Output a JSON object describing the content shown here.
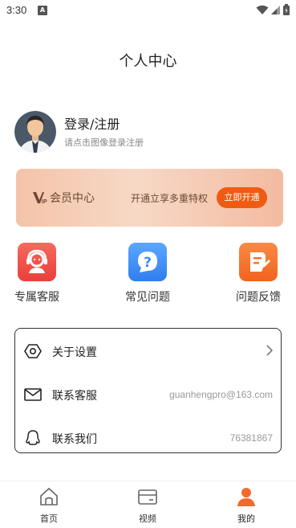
{
  "status_bar": {
    "time": "3:30",
    "notification_letter": "A"
  },
  "header": {
    "title": "个人中心"
  },
  "profile": {
    "name": "登录/注册",
    "subtitle": "请点击图像登录注册"
  },
  "vip": {
    "title": "会员中心",
    "promo": "开通立享多重特权",
    "button": "立即开通",
    "accent": "#ef5b12"
  },
  "quick_actions": [
    {
      "label": "专属客服",
      "icon": "headset-agent-icon",
      "color": "#f0514a"
    },
    {
      "label": "常见问题",
      "icon": "question-bubble-icon",
      "color": "#3d8cf5"
    },
    {
      "label": "问题反馈",
      "icon": "feedback-edit-icon",
      "color": "#f4742c"
    }
  ],
  "menu": [
    {
      "label": "关于设置",
      "value": "",
      "icon": "hexagon-settings-icon"
    },
    {
      "label": "联系客服",
      "value": "guanhengpro@163.com",
      "icon": "mail-icon"
    },
    {
      "label": "联系我们",
      "value": "76381867",
      "icon": "qq-penguin-icon"
    }
  ],
  "tabs": [
    {
      "label": "首页",
      "icon": "home-icon",
      "active": false
    },
    {
      "label": "视频",
      "icon": "video-card-icon",
      "active": false
    },
    {
      "label": "我的",
      "icon": "person-icon",
      "active": true
    }
  ]
}
